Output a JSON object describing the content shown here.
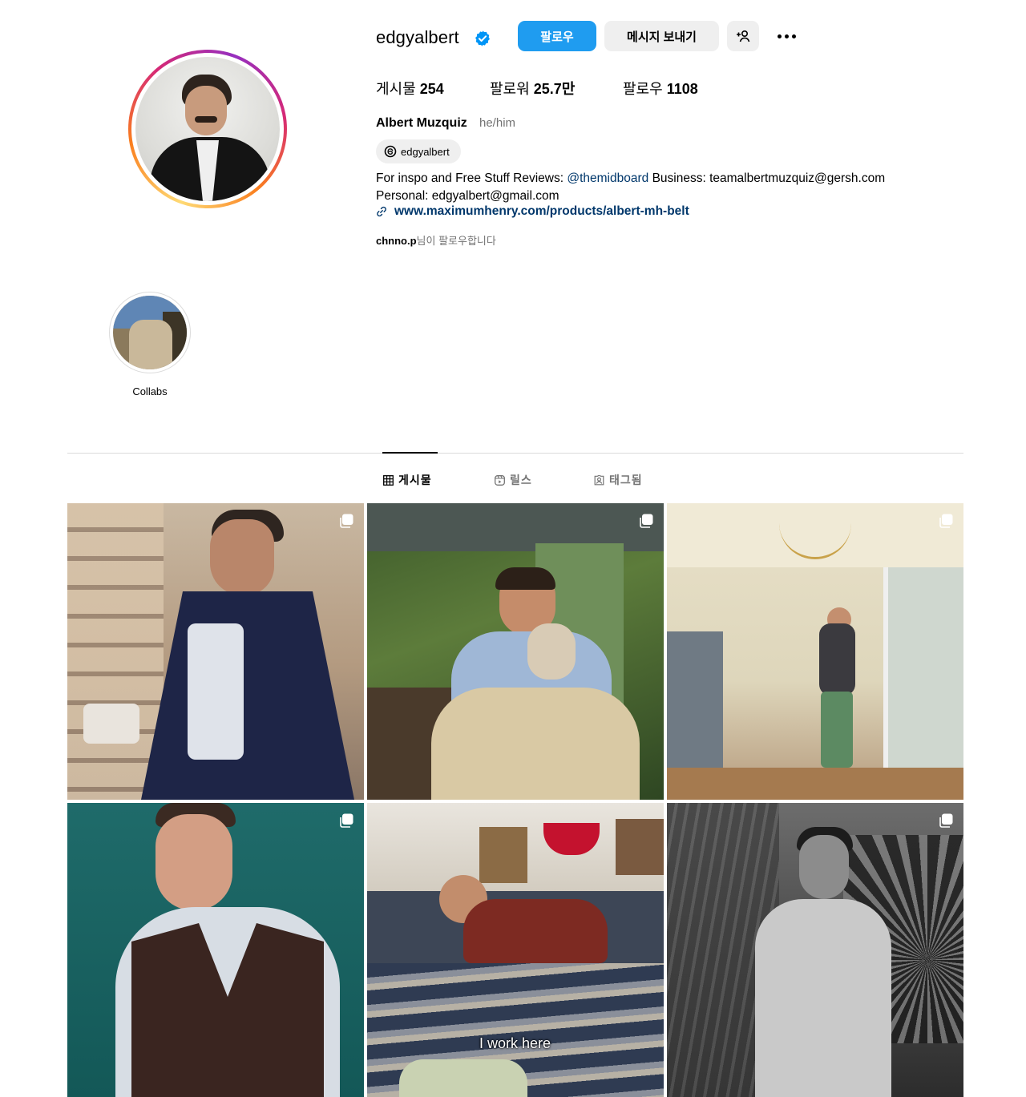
{
  "profile": {
    "username": "edgyalbert",
    "follow_label": "팔로우",
    "message_label": "메시지 보내기",
    "stats": [
      {
        "label": "게시물",
        "value": "254"
      },
      {
        "label": "팔로워",
        "value": "25.7만"
      },
      {
        "label": "팔로우",
        "value": "1108"
      }
    ],
    "full_name": "Albert Muzquiz",
    "pronouns": "he/him",
    "threads_handle": "edgyalbert",
    "bio_prefix": "For inspo and Free Stuff Reviews: ",
    "bio_mention": "@themidboard",
    "bio_suffix": " Business: teamalbertmuzquiz@gersh.com",
    "bio_line2": "Personal: edgyalbert@gmail.com",
    "link": "www.maximumhenry.com/products/albert-mh-belt",
    "followed_by_user": "chnno.p",
    "followed_by_suffix": "님이 팔로우합니다"
  },
  "highlights": [
    {
      "label": "Collabs"
    }
  ],
  "tabs": [
    {
      "label": "게시물",
      "icon": "grid-icon",
      "active": true
    },
    {
      "label": "릴스",
      "icon": "reels-icon",
      "active": false
    },
    {
      "label": "태그됨",
      "icon": "tagged-icon",
      "active": false
    }
  ],
  "posts": [
    {
      "kind": "carousel"
    },
    {
      "kind": "carousel"
    },
    {
      "kind": "carousel"
    },
    {
      "kind": "carousel"
    },
    {
      "kind": "reel",
      "overlay_text": "I work here"
    },
    {
      "kind": "carousel"
    }
  ],
  "colors": {
    "primary_button": "#1f9cf0",
    "secondary_button": "#efefef",
    "link": "#00376b",
    "muted_text": "#737373",
    "verified_badge": "#0095f6"
  }
}
